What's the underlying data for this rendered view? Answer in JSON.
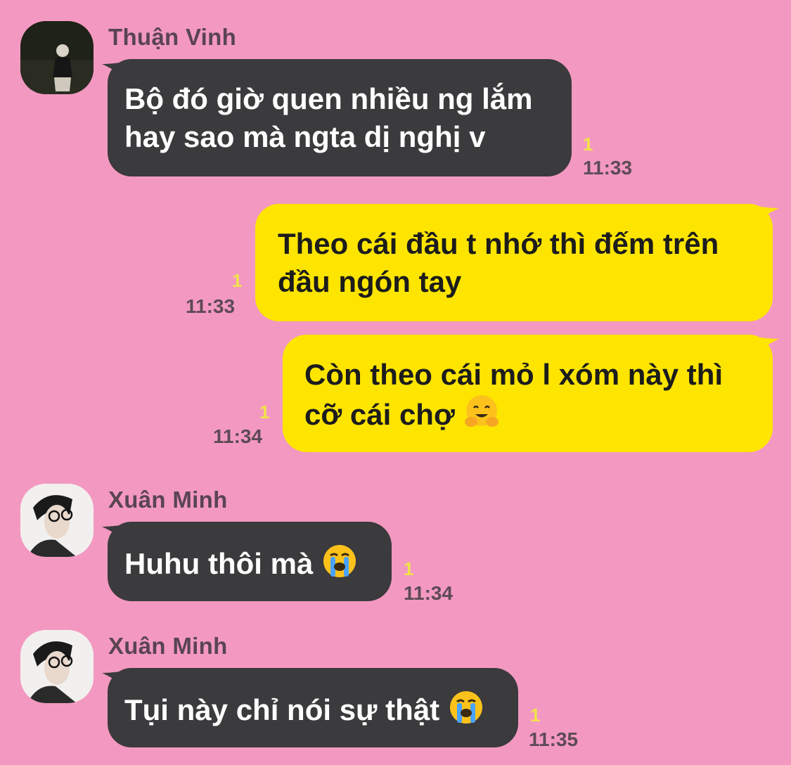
{
  "messages": [
    {
      "sender": "Thuận Vinh",
      "direction": "incoming",
      "lines": [
        "Bộ đó giờ quen nhiều ng lắm",
        "hay sao mà ngta dị nghị v"
      ],
      "unread": "1",
      "time": "11:33"
    },
    {
      "direction": "outgoing",
      "lines": [
        "Theo cái đầu t nhớ thì đếm trên",
        "đầu ngón tay"
      ],
      "unread": "1",
      "time": "11:33"
    },
    {
      "direction": "outgoing",
      "lines": [
        "Còn theo cái mỏ l xóm này thì",
        "cỡ cái chợ"
      ],
      "emoji": "hugging-face",
      "unread": "1",
      "time": "11:34"
    },
    {
      "sender": "Xuân Minh",
      "direction": "incoming",
      "lines": [
        "Huhu thôi mà"
      ],
      "emoji": "loudly-crying-face",
      "unread": "1",
      "time": "11:34"
    },
    {
      "sender": "Xuân Minh",
      "direction": "incoming",
      "lines": [
        "Tụi này chỉ nói sự thật"
      ],
      "emoji": "loudly-crying-face",
      "unread": "1",
      "time": "11:35"
    }
  ],
  "colors": {
    "background": "#f399c1",
    "incoming_bubble": "#3b3a3c",
    "outgoing_bubble": "#fee500",
    "unread": "#f2e24a"
  }
}
